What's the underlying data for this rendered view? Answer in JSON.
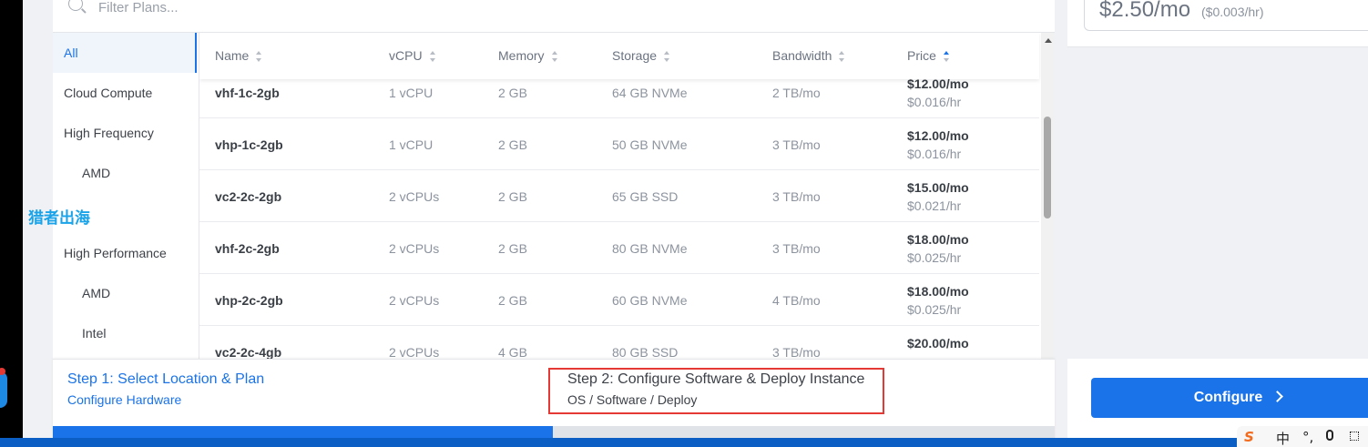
{
  "filter": {
    "placeholder": "Filter Plans..."
  },
  "sidebar": {
    "items": [
      {
        "label": "All",
        "active": true,
        "sub": false
      },
      {
        "label": "Cloud Compute",
        "active": false,
        "sub": false
      },
      {
        "label": "High Frequency",
        "active": false,
        "sub": false
      },
      {
        "label": "AMD",
        "active": false,
        "sub": true
      },
      {
        "label": "High Performance",
        "active": false,
        "sub": false
      },
      {
        "label": "AMD",
        "active": false,
        "sub": true
      },
      {
        "label": "Intel",
        "active": false,
        "sub": true
      }
    ]
  },
  "watermark": "猎者出海",
  "table": {
    "headers": [
      "Name",
      "vCPU",
      "Memory",
      "Storage",
      "Bandwidth",
      "Price"
    ],
    "sorted_column": "Price",
    "rows": [
      {
        "name": "vhf-1c-2gb",
        "vcpu": "1 vCPU",
        "memory": "2 GB",
        "storage": "64 GB NVMe",
        "bandwidth": "2 TB/mo",
        "price_mo": "$12.00/mo",
        "price_hr": "$0.016/hr"
      },
      {
        "name": "vhp-1c-2gb",
        "vcpu": "1 vCPU",
        "memory": "2 GB",
        "storage": "50 GB NVMe",
        "bandwidth": "3 TB/mo",
        "price_mo": "$12.00/mo",
        "price_hr": "$0.016/hr"
      },
      {
        "name": "vc2-2c-2gb",
        "vcpu": "2 vCPUs",
        "memory": "2 GB",
        "storage": "65 GB SSD",
        "bandwidth": "3 TB/mo",
        "price_mo": "$15.00/mo",
        "price_hr": "$0.021/hr"
      },
      {
        "name": "vhf-2c-2gb",
        "vcpu": "2 vCPUs",
        "memory": "2 GB",
        "storage": "80 GB NVMe",
        "bandwidth": "3 TB/mo",
        "price_mo": "$18.00/mo",
        "price_hr": "$0.025/hr"
      },
      {
        "name": "vhp-2c-2gb",
        "vcpu": "2 vCPUs",
        "memory": "2 GB",
        "storage": "60 GB NVMe",
        "bandwidth": "4 TB/mo",
        "price_mo": "$18.00/mo",
        "price_hr": "$0.025/hr"
      },
      {
        "name": "vc2-2c-4gb",
        "vcpu": "2 vCPUs",
        "memory": "4 GB",
        "storage": "80 GB SSD",
        "bandwidth": "3 TB/mo",
        "price_mo": "$20.00/mo",
        "price_hr": ""
      }
    ]
  },
  "summary": {
    "price_mo": "$2.50/mo",
    "price_hr": "($0.003/hr)"
  },
  "steps": {
    "step1": {
      "title": "Step 1: Select Location & Plan",
      "subtitle": "Configure Hardware"
    },
    "step2": {
      "title": "Step 2: Configure Software & Deploy Instance",
      "subtitle": "OS / Software / Deploy"
    },
    "progress": 0.5
  },
  "configure": {
    "label": "Configure"
  },
  "ime": {
    "lang": "中",
    "punct": "°,"
  },
  "colors": {
    "accent": "#1a73e8",
    "highlight_box": "#e53935",
    "taskbar": "#0b5fc4"
  },
  "icons": [
    "search-icon",
    "sort-icon",
    "chevron-right-icon",
    "scroll-up-icon",
    "sogou-ime-icon",
    "microphone-icon",
    "keyboard-grid-icon"
  ]
}
